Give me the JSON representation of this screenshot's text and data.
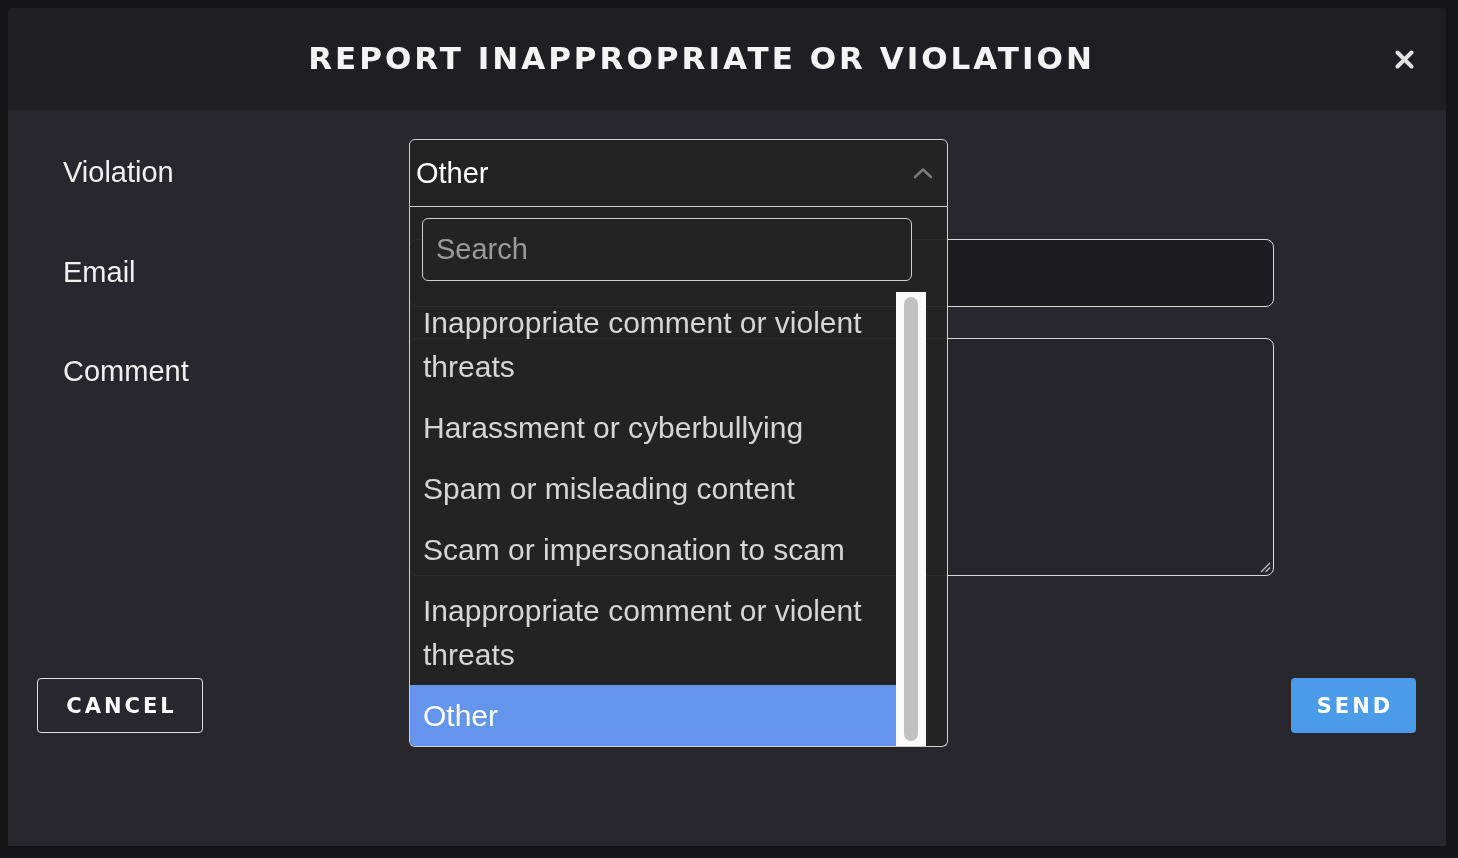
{
  "dialog": {
    "title": "REPORT INAPPROPRIATE OR VIOLATION"
  },
  "fields": [
    {
      "kind": "select",
      "label": "Violation",
      "value": "Other",
      "expanded": true,
      "search": {
        "placeholder": "Search"
      },
      "options": [
        {
          "label": "Inappropriate comment or violent threats",
          "selected": false
        },
        {
          "label": "Harassment or cyberbullying",
          "selected": false
        },
        {
          "label": "Spam or misleading content",
          "selected": false
        },
        {
          "label": "Scam or impersonation to scam",
          "selected": false
        },
        {
          "label": "Inappropriate comment or violent threats",
          "selected": false
        },
        {
          "label": "Other",
          "selected": true
        }
      ]
    },
    {
      "kind": "input",
      "label": "Email"
    },
    {
      "kind": "textarea",
      "label": "Comment"
    }
  ],
  "buttons": [
    {
      "kind": "cancel",
      "label": "CANCEL"
    },
    {
      "kind": "send",
      "label": "SEND"
    }
  ]
}
